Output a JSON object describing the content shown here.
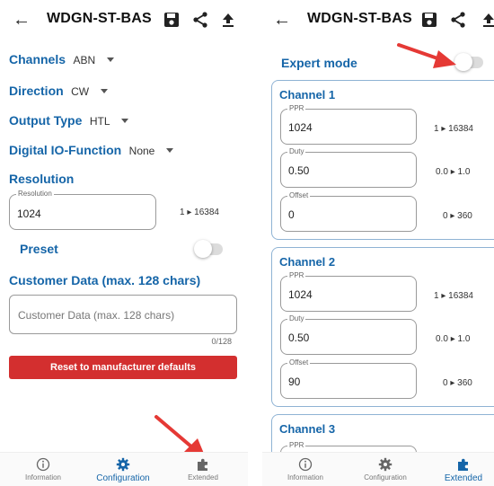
{
  "left": {
    "header": {
      "title": "WDGN-ST-BAS"
    },
    "channels": {
      "label": "Channels",
      "value": "ABN"
    },
    "direction": {
      "label": "Direction",
      "value": "CW"
    },
    "output_type": {
      "label": "Output Type",
      "value": "HTL"
    },
    "digital_io": {
      "label": "Digital IO-Function",
      "value": "None"
    },
    "resolution": {
      "section": "Resolution",
      "legend": "Resolution",
      "value": "1024",
      "range_min": "1",
      "range_max": "16384"
    },
    "preset": {
      "label": "Preset",
      "state": "off"
    },
    "customer": {
      "section": "Customer Data (max. 128 chars)",
      "placeholder": "Customer Data (max. 128 chars)",
      "counter": "0/128"
    },
    "reset_label": "Reset to manufacturer defaults",
    "nav": [
      {
        "label": "Information",
        "icon": "info-icon",
        "active": false
      },
      {
        "label": "Configuration",
        "icon": "gear-icon",
        "active": true
      },
      {
        "label": "Extended",
        "icon": "puzzle-icon",
        "active": false
      }
    ]
  },
  "right": {
    "header": {
      "title": "WDGN-ST-BAS"
    },
    "expert_mode": {
      "label": "Expert mode",
      "state": "off"
    },
    "channels": [
      {
        "title": "Channel 1",
        "fields": [
          {
            "legend": "PPR",
            "value": "1024",
            "range_min": "1",
            "range_max": "16384"
          },
          {
            "legend": "Duty",
            "value": "0.50",
            "range_min": "0.0",
            "range_max": "1.0"
          },
          {
            "legend": "Offset",
            "value": "0",
            "range_min": "0",
            "range_max": "360"
          }
        ]
      },
      {
        "title": "Channel 2",
        "fields": [
          {
            "legend": "PPR",
            "value": "1024",
            "range_min": "1",
            "range_max": "16384"
          },
          {
            "legend": "Duty",
            "value": "0.50",
            "range_min": "0.0",
            "range_max": "1.0"
          },
          {
            "legend": "Offset",
            "value": "90",
            "range_min": "0",
            "range_max": "360"
          }
        ]
      },
      {
        "title": "Channel 3",
        "fields": [
          {
            "legend": "PPR"
          }
        ]
      }
    ],
    "nav": [
      {
        "label": "Information",
        "icon": "info-icon",
        "active": false
      },
      {
        "label": "Configuration",
        "icon": "gear-icon",
        "active": false
      },
      {
        "label": "Extended",
        "icon": "puzzle-icon",
        "active": true
      }
    ]
  },
  "colors": {
    "accent": "#1565a8",
    "danger": "#d32f2f",
    "arrow": "#e53935"
  }
}
